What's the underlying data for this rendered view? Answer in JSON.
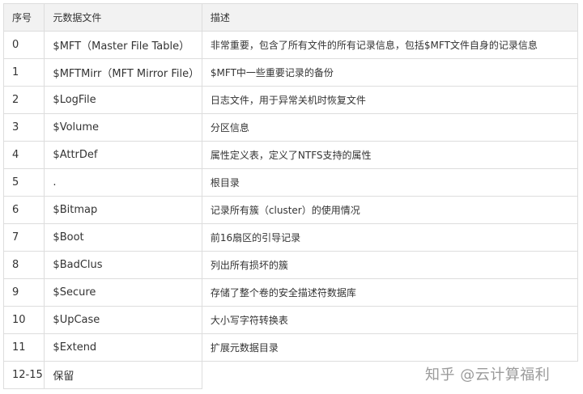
{
  "table": {
    "headers": {
      "id": "序号",
      "name": "元数据文件",
      "desc": "描述"
    },
    "rows": [
      {
        "id": "0",
        "name": "$MFT（Master File Table）",
        "desc": "非常重要，包含了所有文件的所有记录信息，包括$MFT文件自身的记录信息"
      },
      {
        "id": "1",
        "name": "$MFTMirr（MFT Mirror File）",
        "desc": "$MFT中一些重要记录的备份"
      },
      {
        "id": "2",
        "name": "$LogFile",
        "desc": "日志文件，用于异常关机时恢复文件"
      },
      {
        "id": "3",
        "name": "$Volume",
        "desc": "分区信息"
      },
      {
        "id": "4",
        "name": "$AttrDef",
        "desc": "属性定义表，定义了NTFS支持的属性"
      },
      {
        "id": "5",
        "name": ".",
        "desc": "根目录"
      },
      {
        "id": "6",
        "name": "$Bitmap",
        "desc": "记录所有簇（cluster）的使用情况"
      },
      {
        "id": "7",
        "name": "$Boot",
        "desc": "前16扇区的引导记录"
      },
      {
        "id": "8",
        "name": "$BadClus",
        "desc": "列出所有损坏的簇"
      },
      {
        "id": "9",
        "name": "$Secure",
        "desc": "存储了整个卷的安全描述符数据库"
      },
      {
        "id": "10",
        "name": "$UpCase",
        "desc": "大小写字符转换表"
      },
      {
        "id": "11",
        "name": "$Extend",
        "desc": "扩展元数据目录"
      },
      {
        "id": "12-15",
        "name": "保留",
        "desc": ""
      }
    ]
  },
  "watermark": {
    "text": "知乎 @云计算福利"
  }
}
